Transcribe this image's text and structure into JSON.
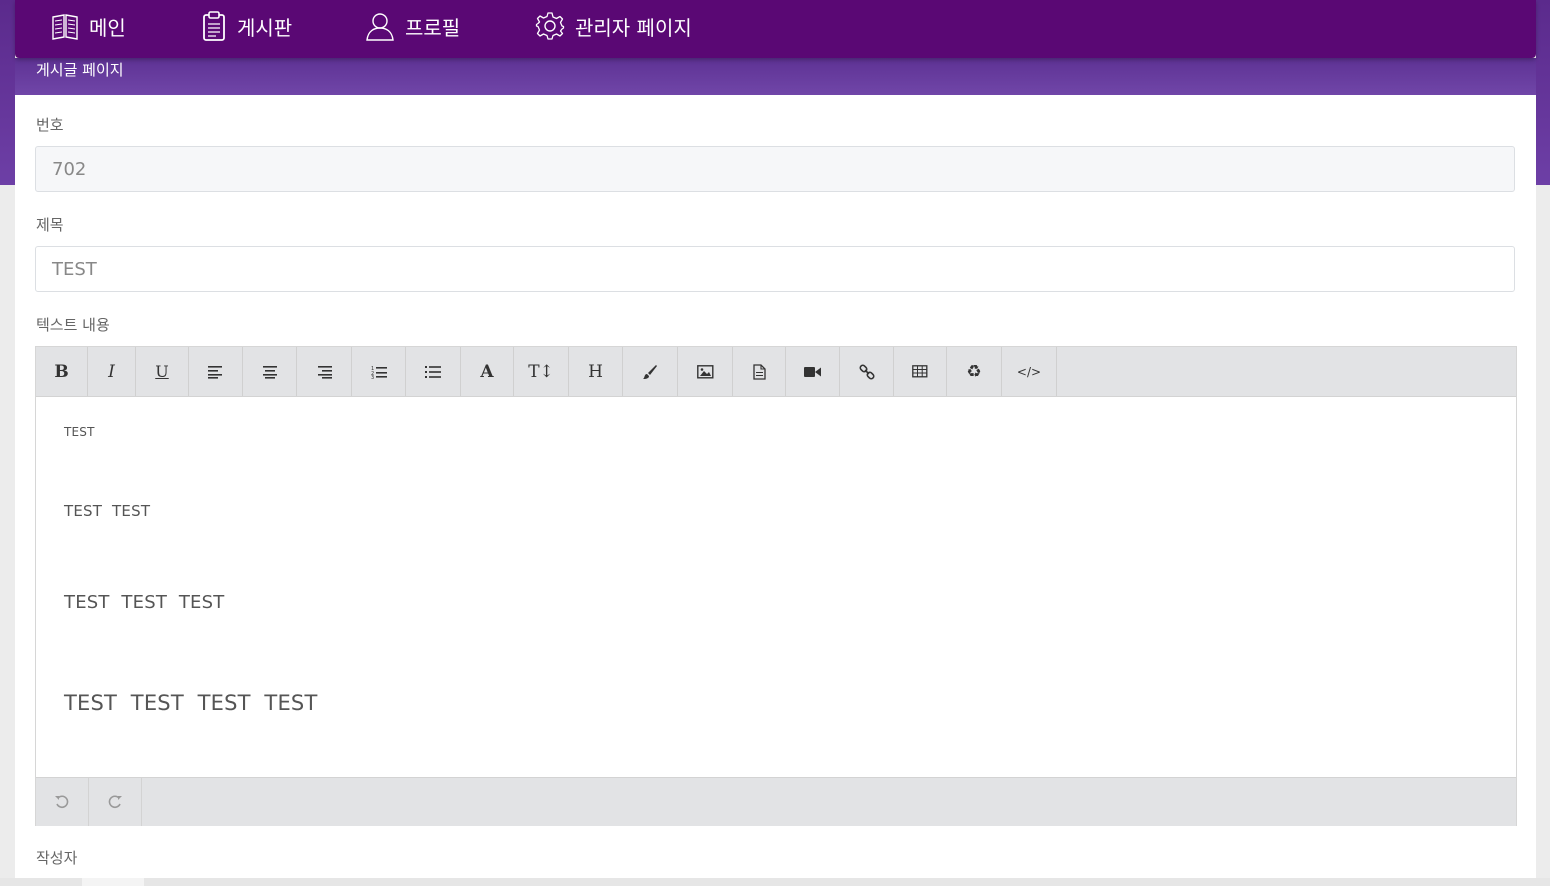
{
  "nav": {
    "items": [
      {
        "label": "메인",
        "icon": "book-icon"
      },
      {
        "label": "게시판",
        "icon": "clipboard-icon"
      },
      {
        "label": "프로필",
        "icon": "user-icon"
      },
      {
        "label": "관리자 페이지",
        "icon": "gear-icon"
      }
    ]
  },
  "header": {
    "title": "게시글 페이지"
  },
  "form": {
    "number_label": "번호",
    "number_value": "702",
    "title_label": "제목",
    "title_value": "TEST",
    "content_label": "텍스트 내용",
    "author_label": "작성자"
  },
  "editor": {
    "toolbar": [
      {
        "name": "bold-button",
        "glyph": "B"
      },
      {
        "name": "italic-button",
        "glyph": "I"
      },
      {
        "name": "underline-button",
        "glyph": "U"
      },
      {
        "name": "align-left-button",
        "glyph": ""
      },
      {
        "name": "align-center-button",
        "glyph": ""
      },
      {
        "name": "align-right-button",
        "glyph": ""
      },
      {
        "name": "ordered-list-button",
        "glyph": ""
      },
      {
        "name": "unordered-list-button",
        "glyph": ""
      },
      {
        "name": "font-color-button",
        "glyph": "A"
      },
      {
        "name": "font-size-button",
        "glyph": "T↕"
      },
      {
        "name": "heading-button",
        "glyph": "H"
      },
      {
        "name": "brush-button",
        "glyph": ""
      },
      {
        "name": "image-button",
        "glyph": ""
      },
      {
        "name": "file-button",
        "glyph": ""
      },
      {
        "name": "video-button",
        "glyph": ""
      },
      {
        "name": "link-button",
        "glyph": ""
      },
      {
        "name": "table-button",
        "glyph": ""
      },
      {
        "name": "recycle-button",
        "glyph": "♻"
      },
      {
        "name": "code-button",
        "glyph": "</>"
      }
    ],
    "lines": [
      "TEST",
      "TEST  TEST",
      "TEST  TEST  TEST",
      "TEST  TEST  TEST  TEST"
    ]
  },
  "colors": {
    "nav_bg": "#5a0874",
    "header_bg": "#6a3ea3",
    "toolbar_bg": "#e2e3e5"
  }
}
